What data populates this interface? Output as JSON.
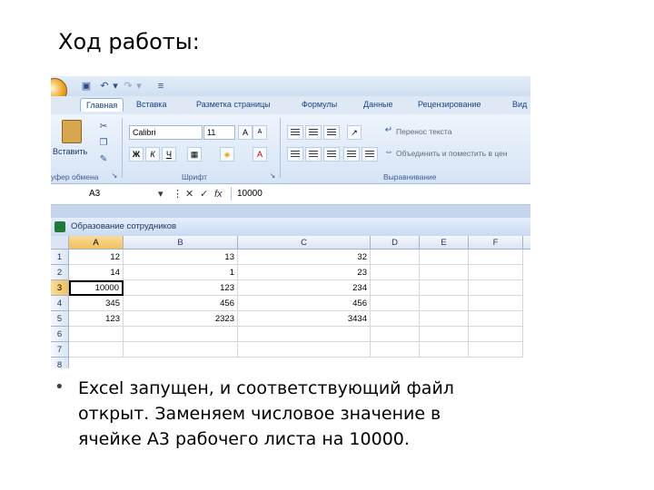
{
  "slide": {
    "title": "Ход работы:",
    "bullet": "Excel запущен, и соответствующий файл открыт. Заменяем числовое значение в ячейке А3 рабочего листа на 10000."
  },
  "excel": {
    "tabs": [
      "Главная",
      "Вставка",
      "Разметка страницы",
      "Формулы",
      "Данные",
      "Рецензирование",
      "Вид"
    ],
    "ribbon": {
      "paste_label": "Вставить",
      "clipboard_group": "уфер обмена",
      "font_name": "Calibri",
      "font_size": "11",
      "font_group": "Шрифт",
      "wrap_text": "Перенос текста",
      "merge_center": "Объединить и поместить в цен",
      "align_group": "Выравнивание",
      "bold": "Ж",
      "italic": "К",
      "underline": "Ч"
    },
    "formula_bar": {
      "name_box": "A3",
      "fx": "fx",
      "value": "10000"
    },
    "workbook_title": "Образование сотрудников",
    "columns": [
      "A",
      "B",
      "C",
      "D",
      "E",
      "F"
    ],
    "rows": [
      "1",
      "2",
      "3",
      "4",
      "5",
      "6",
      "7",
      "8"
    ],
    "cells": [
      [
        "12",
        "13",
        "32"
      ],
      [
        "14",
        "1",
        "23"
      ],
      [
        "10000",
        "123",
        "234"
      ],
      [
        "345",
        "456",
        "456"
      ],
      [
        "123",
        "2323",
        "3434"
      ]
    ],
    "colors": {
      "ribbon_bg": "#d6e4f6",
      "selected_header": "#f3c05c"
    }
  }
}
